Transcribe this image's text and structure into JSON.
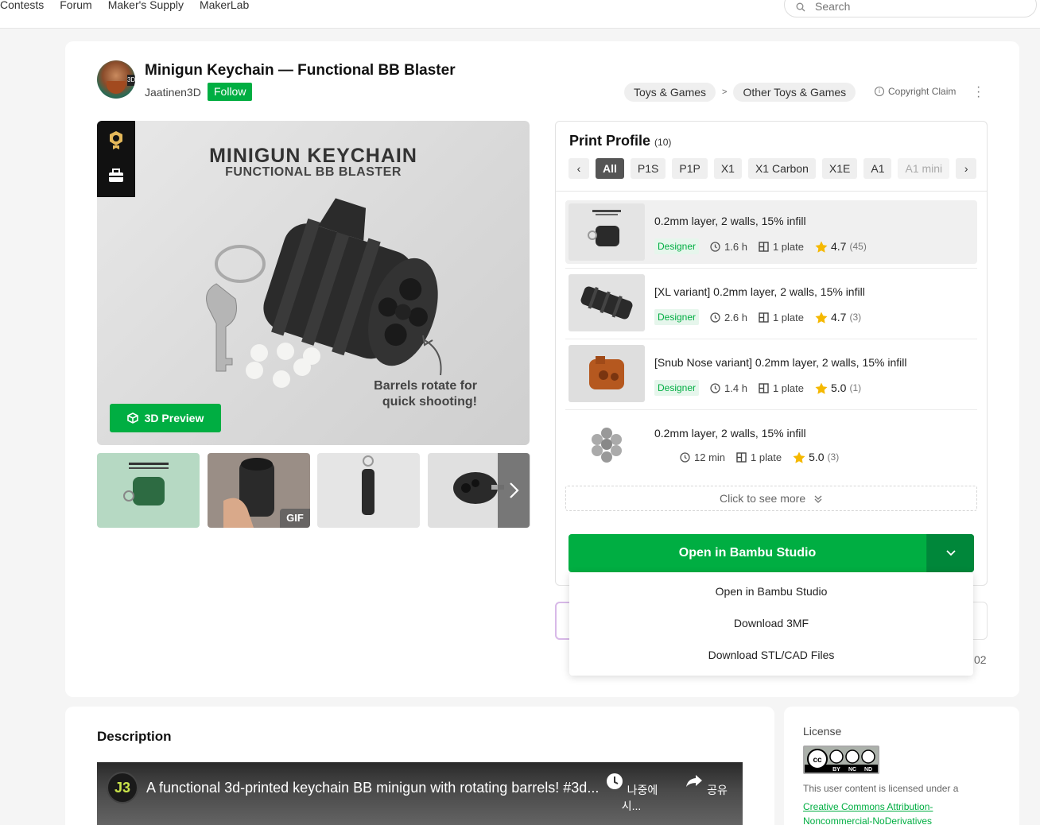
{
  "nav": {
    "links": [
      "Contests",
      "Forum",
      "Maker's Supply",
      "MakerLab"
    ],
    "search_placeholder": "Search"
  },
  "model": {
    "title": "Minigun Keychain — Functional BB Blaster",
    "author": "Jaatinen3D",
    "follow_label": "Follow",
    "category": "Toys & Games",
    "subcategory": "Other Toys & Games",
    "category_separator": ">",
    "copyright_label": "Copyright Claim"
  },
  "gallery": {
    "image_heading": "MINIGUN KEYCHAIN",
    "image_subheading": "FUNCTIONAL BB BLASTER",
    "image_caption_line1": "Barrels rotate for",
    "image_caption_line2": "quick shooting!",
    "preview_label": "3D Preview",
    "gif_badge": "GIF"
  },
  "print_profile": {
    "title": "Print Profile",
    "count": "(10)",
    "printers": [
      "All",
      "P1S",
      "P1P",
      "X1",
      "X1 Carbon",
      "X1E",
      "A1",
      "A1 mini"
    ],
    "active_printer": "All",
    "profiles": [
      {
        "name": "0.2mm layer, 2 walls, 15% infill",
        "badge": "Designer",
        "time": "1.6 h",
        "plates": "1 plate",
        "rating": "4.7",
        "ratings_count": "(45)"
      },
      {
        "name": "[XL variant] 0.2mm layer, 2 walls, 15% infill",
        "badge": "Designer",
        "time": "2.6 h",
        "plates": "1 plate",
        "rating": "4.7",
        "ratings_count": "(3)"
      },
      {
        "name": "[Snub Nose variant] 0.2mm layer, 2 walls, 15% infill",
        "badge": "Designer",
        "time": "1.4 h",
        "plates": "1 plate",
        "rating": "5.0",
        "ratings_count": "(1)"
      },
      {
        "name": "0.2mm layer, 2 walls, 15% infill",
        "badge": "",
        "time": "12 min",
        "plates": "1 plate",
        "rating": "5.0",
        "ratings_count": "(3)"
      }
    ],
    "see_more": "Click to see more",
    "open_button": "Open in Bambu Studio",
    "dropdown": [
      "Open in Bambu Studio",
      "Download 3MF",
      "Download STL/CAD Files"
    ],
    "partial_number": "02"
  },
  "description": {
    "title": "Description",
    "video_title": "A functional 3d-printed keychain BB minigun with rotating barrels! #3d...",
    "video_logo": "J3",
    "watch_later": "나중에 시...",
    "share": "공유"
  },
  "license": {
    "title": "License",
    "badge_labels": [
      "BY",
      "NC",
      "ND"
    ],
    "text": "This user content is licensed under a",
    "link_line1": "Creative Commons Attribution-",
    "link_line2": "Noncommercial-NoDerivatives"
  },
  "colors": {
    "brand_green": "#00ae42",
    "dark_green": "#00873a",
    "star": "#f5b800"
  }
}
